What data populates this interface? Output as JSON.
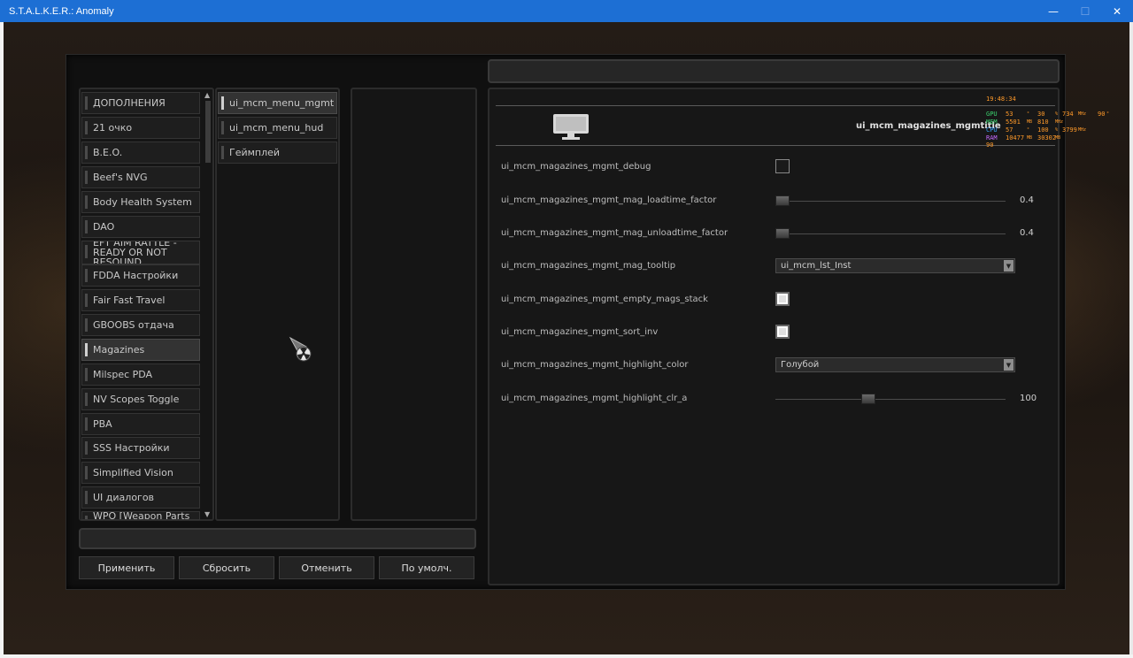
{
  "window": {
    "title": "S.T.A.L.K.E.R.: Anomaly",
    "minimize_glyph": "—",
    "maximize_glyph": "☐",
    "close_glyph": "✕"
  },
  "categories": [
    {
      "label": "ДОПОЛНЕНИЯ"
    },
    {
      "label": "21 очко"
    },
    {
      "label": "B.E.O."
    },
    {
      "label": "Beef's NVG"
    },
    {
      "label": "Body Health System"
    },
    {
      "label": "DAO"
    },
    {
      "label": "EFT AIM RATTLE - READY OR NOT RESOUND"
    },
    {
      "label": "FDDA Настройки"
    },
    {
      "label": "Fair Fast Travel"
    },
    {
      "label": "GBOOBS отдача"
    },
    {
      "label": "Magazines"
    },
    {
      "label": "Milspec PDA"
    },
    {
      "label": "NV Scopes Toggle"
    },
    {
      "label": "PBA"
    },
    {
      "label": "SSS Настройки"
    },
    {
      "label": "Simplified Vision"
    },
    {
      "label": "UI диалогов"
    },
    {
      "label": "WPO [Weapon Parts"
    }
  ],
  "submenu": [
    {
      "label": "ui_mcm_menu_mgmt"
    },
    {
      "label": "ui_mcm_menu_hud"
    },
    {
      "label": "Геймплей"
    }
  ],
  "buttons": {
    "apply": "Применить",
    "reset": "Сбросить",
    "cancel": "Отменить",
    "default": "По умолч."
  },
  "options_title": "ui_mcm_magazines_mgmtitle",
  "options": {
    "debug": {
      "label": "ui_mcm_magazines_mgmt_debug",
      "checked": false
    },
    "loadtime": {
      "label": "ui_mcm_magazines_mgmt_mag_loadtime_factor",
      "value": "0.4"
    },
    "unloadtime": {
      "label": "ui_mcm_magazines_mgmt_mag_unloadtime_factor",
      "value": "0.4"
    },
    "tooltip": {
      "label": "ui_mcm_magazines_mgmt_mag_tooltip",
      "selected": "ui_mcm_lst_Inst"
    },
    "empty_stack": {
      "label": "ui_mcm_magazines_mgmt_empty_mags_stack",
      "checked": true
    },
    "sort_inv": {
      "label": "ui_mcm_magazines_mgmt_sort_inv",
      "checked": true
    },
    "highlight_color": {
      "label": "ui_mcm_magazines_mgmt_highlight_color",
      "selected": "Голубой"
    },
    "highlight_alpha": {
      "label": "ui_mcm_magazines_mgmt_highlight_clr_a",
      "value": "100"
    }
  },
  "osd": {
    "time": "19:48:34",
    "rows": [
      {
        "name": "GPU",
        "a": "53",
        "a_unit": "°",
        "b": "30",
        "b_unit": "%",
        "c": "734",
        "c_unit": "MHz",
        "d": "90",
        "d_unit": "°"
      },
      {
        "name": "MEM",
        "a": "5501",
        "a_unit": "MB",
        "b": "810",
        "b_unit": "MHz",
        "c": "",
        "c_unit": "",
        "d": "",
        "d_unit": ""
      },
      {
        "name": "CPU",
        "a": "57",
        "a_unit": "°",
        "b": "100",
        "b_unit": "%",
        "c": "3799",
        "c_unit": "MHz",
        "d": "",
        "d_unit": ""
      },
      {
        "name": "RAM",
        "a": "10477",
        "a_unit": "MB",
        "b": "30302",
        "b_unit": "MB",
        "c": "",
        "c_unit": "",
        "d": "",
        "d_unit": ""
      }
    ],
    "fps": "90",
    "colors": {
      "time": "#ff9a2a",
      "gpu": "#3bd16f",
      "mem": "#3bd16f",
      "cpu": "#3aa6ff",
      "ram": "#c46aff",
      "value": "#ff9a2a"
    }
  },
  "icons": {
    "monitor": "monitor-icon",
    "cursor": "radiation-cursor-icon"
  }
}
